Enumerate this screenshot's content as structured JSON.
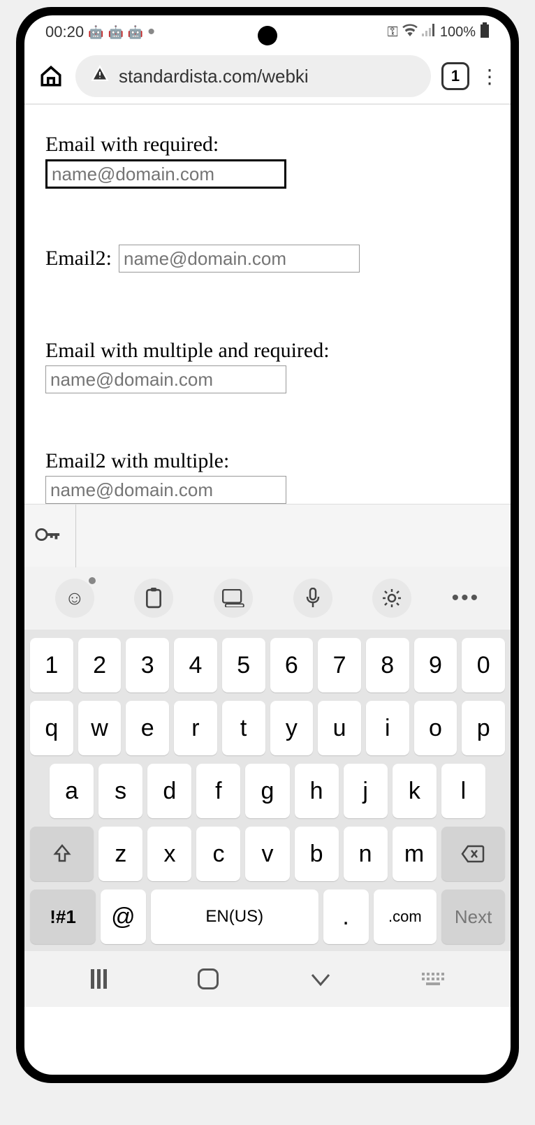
{
  "status": {
    "time": "00:20",
    "battery": "100%"
  },
  "browser": {
    "url": "standardista.com/webki",
    "tabs": "1"
  },
  "fields": {
    "f1": {
      "label": "Email with required:",
      "placeholder": "name@domain.com"
    },
    "f2": {
      "label": "Email2:",
      "placeholder": "name@domain.com"
    },
    "f3": {
      "label": "Email with multiple and required:",
      "placeholder": "name@domain.com"
    },
    "f4": {
      "label": "Email2 with multiple:",
      "placeholder": "name@domain.com"
    }
  },
  "keyboard": {
    "row1": [
      "1",
      "2",
      "3",
      "4",
      "5",
      "6",
      "7",
      "8",
      "9",
      "0"
    ],
    "row2": [
      "q",
      "w",
      "e",
      "r",
      "t",
      "y",
      "u",
      "i",
      "o",
      "p"
    ],
    "row3": [
      "a",
      "s",
      "d",
      "f",
      "g",
      "h",
      "j",
      "k",
      "l"
    ],
    "row4": [
      "z",
      "x",
      "c",
      "v",
      "b",
      "n",
      "m"
    ],
    "sym": "!#1",
    "at": "@",
    "space": "EN(US)",
    "period": ".",
    "com": ".com",
    "next": "Next"
  }
}
